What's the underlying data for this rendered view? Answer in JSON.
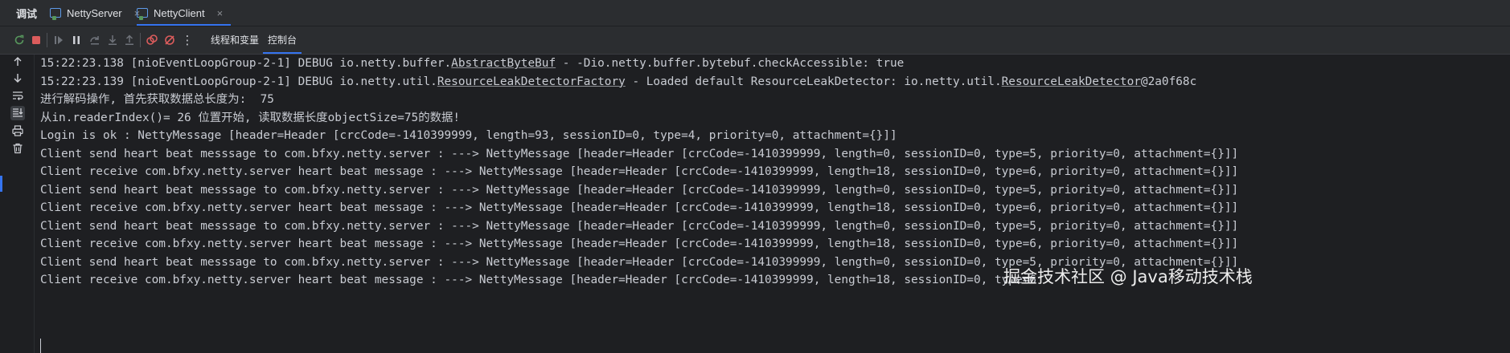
{
  "tabbar": {
    "title": "调试",
    "tabs": [
      {
        "label": "NettyServer",
        "active": false
      },
      {
        "label": "NettyClient",
        "active": true
      }
    ],
    "close_glyph": "×"
  },
  "toolbar": {
    "icons": [
      "rerun-icon",
      "stop-icon",
      "resume-icon",
      "pause-icon",
      "step-over-icon",
      "step-into-icon",
      "step-out-icon",
      "view-breakpoints-icon",
      "mute-breakpoints-icon",
      "more-icon"
    ],
    "more_glyph": "⋮",
    "tabs": [
      {
        "label": "线程和变量",
        "active": false
      },
      {
        "label": "控制台",
        "active": true
      }
    ]
  },
  "gutter": {
    "icons": [
      "up-arrow-icon",
      "down-arrow-icon",
      "soft-wrap-icon",
      "scroll-to-end-icon",
      "print-icon",
      "clear-all-icon"
    ]
  },
  "console": {
    "lines": [
      {
        "segments": [
          {
            "t": "15:22:23.138 [nioEventLoopGroup-2-1] DEBUG io.netty.buffer."
          },
          {
            "t": "AbstractByteBuf",
            "u": true
          },
          {
            "t": " - -Dio.netty.buffer.bytebuf.checkAccessible: true"
          }
        ]
      },
      {
        "segments": [
          {
            "t": "15:22:23.139 [nioEventLoopGroup-2-1] DEBUG io.netty.util."
          },
          {
            "t": "ResourceLeakDetectorFactory",
            "u": true
          },
          {
            "t": " - Loaded default ResourceLeakDetector: io.netty.util."
          },
          {
            "t": "ResourceLeakDetector",
            "u": true
          },
          {
            "t": "@2a0f68c"
          }
        ]
      },
      {
        "segments": [
          {
            "t": "进行解码操作, 首先获取数据总长度为:  75"
          }
        ]
      },
      {
        "segments": [
          {
            "t": "从in.readerIndex()= 26 位置开始, 读取数据长度objectSize=75的数据!"
          }
        ]
      },
      {
        "segments": [
          {
            "t": "Login is ok : NettyMessage [header=Header [crcCode=-1410399999, length=93, sessionID=0, type=4, priority=0, attachment={}]]"
          }
        ]
      },
      {
        "segments": [
          {
            "t": "Client send heart beat messsage to com.bfxy.netty.server : ---> NettyMessage [header=Header [crcCode=-1410399999, length=0, sessionID=0, type=5, priority=0, attachment={}]]"
          }
        ]
      },
      {
        "segments": [
          {
            "t": "Client receive com.bfxy.netty.server heart beat message : ---> NettyMessage [header=Header [crcCode=-1410399999, length=18, sessionID=0, type=6, priority=0, attachment={}]]"
          }
        ]
      },
      {
        "segments": [
          {
            "t": "Client send heart beat messsage to com.bfxy.netty.server : ---> NettyMessage [header=Header [crcCode=-1410399999, length=0, sessionID=0, type=5, priority=0, attachment={}]]"
          }
        ]
      },
      {
        "segments": [
          {
            "t": "Client receive com.bfxy.netty.server heart beat message : ---> NettyMessage [header=Header [crcCode=-1410399999, length=18, sessionID=0, type=6, priority=0, attachment={}]]"
          }
        ]
      },
      {
        "segments": [
          {
            "t": "Client send heart beat messsage to com.bfxy.netty.server : ---> NettyMessage [header=Header [crcCode=-1410399999, length=0, sessionID=0, type=5, priority=0, attachment={}]]"
          }
        ]
      },
      {
        "segments": [
          {
            "t": "Client receive com.bfxy.netty.server heart beat message : ---> NettyMessage [header=Header [crcCode=-1410399999, length=18, sessionID=0, type=6, priority=0, attachment={}]]"
          }
        ]
      },
      {
        "segments": [
          {
            "t": "Client send heart beat messsage to com.bfxy.netty.server : ---> NettyMessage [header=Header [crcCode=-1410399999, length=0, sessionID=0, type=5, priority=0, attachment={}]]"
          }
        ]
      },
      {
        "segments": [
          {
            "t": "Client receive com.bfxy.netty.server heart beat message : ---> NettyMessage [header=Header [crcCode=-1410399999, length=18, sessionID=0, type=6"
          }
        ]
      }
    ]
  },
  "watermark": "掘金技术社区 @ Java移动技术栈",
  "colors": {
    "background": "#1e1f22",
    "panel": "#2b2d30",
    "text": "#c9ccd3",
    "accent": "#3574f0",
    "stop_red": "#db5c5c",
    "rerun_green": "#57965c"
  }
}
